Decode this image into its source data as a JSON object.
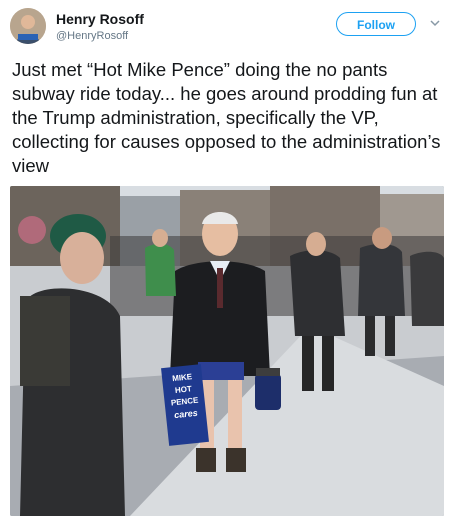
{
  "tweet": {
    "author_name": "Henry Rosoff",
    "author_handle": "@HenryRosoff",
    "follow_label": "Follow",
    "text": "Just met “Hot Mike Pence” doing the no pants subway ride today... he goes around prodding fun at the Trump administration, specifically the VP, collecting for causes opposed to the administration’s view"
  },
  "photo": {
    "sign_lines": [
      "MIKE",
      "HOT",
      "PENCE",
      "cares"
    ]
  },
  "icons": {
    "chevron": "chevron-down-icon",
    "avatar": "avatar"
  },
  "colors": {
    "accent": "#1da1f2",
    "text": "#14171a",
    "muted": "#657786",
    "sign_blue": "#1f3a8f"
  }
}
